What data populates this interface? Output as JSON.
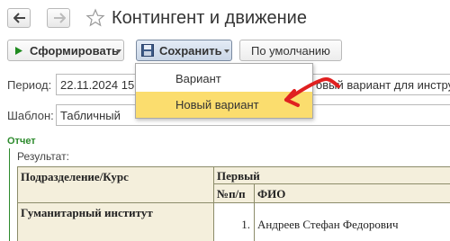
{
  "window": {
    "title": "Контингент и движение"
  },
  "toolbar": {
    "generate_label": "Сформировать",
    "save_label": "Сохранить",
    "default_label": "По умолчанию"
  },
  "form": {
    "period_label": "Период:",
    "period_value": "22.11.2024 15:",
    "period_overflow_text": "овый вариант для инструк",
    "template_label": "Шаблон:",
    "template_value": "Табличный"
  },
  "report": {
    "section_title": "Отчет",
    "result_label": "Результат:",
    "headers": {
      "department": "Подразделение/Курс",
      "first": "Первый",
      "num": "№п/п",
      "fio": "ФИО"
    },
    "rows": [
      {
        "department": "Гуманитарный институт",
        "num": "1.",
        "fio": "Андреев Стефан Федорович"
      }
    ]
  },
  "save_menu": {
    "items": [
      {
        "label": "Вариант",
        "selected": false
      },
      {
        "label": "Новый вариант",
        "selected": true
      }
    ]
  },
  "colors": {
    "highlight": "#fbdd6e",
    "arrow": "#e02020",
    "report_header_bg": "#f4efdc",
    "section_green": "#2e8b2e"
  }
}
